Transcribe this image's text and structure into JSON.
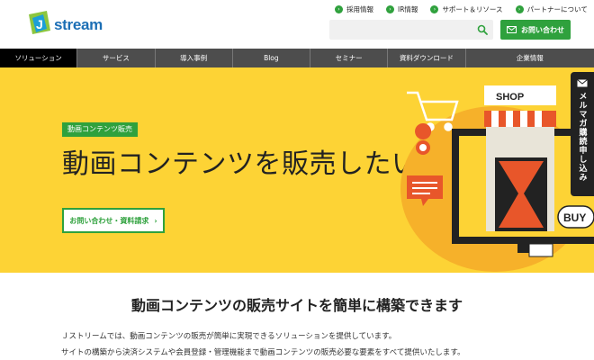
{
  "header": {
    "logo_text": "stream",
    "logo_letter": "J",
    "util_links": [
      {
        "label": "採用情報"
      },
      {
        "label": "IR情報"
      },
      {
        "label": "サポート＆リソース"
      },
      {
        "label": "パートナーについて"
      }
    ],
    "search": {
      "placeholder": "",
      "value": ""
    },
    "contact_label": "お問い合わせ"
  },
  "nav": {
    "items": [
      {
        "label": "ソリューション",
        "active": true
      },
      {
        "label": "サービス"
      },
      {
        "label": "導入事例"
      },
      {
        "label": "Blog"
      },
      {
        "label": "セミナー"
      },
      {
        "label": "資料ダウンロード"
      },
      {
        "label": "企業情報"
      }
    ]
  },
  "hero": {
    "badge": "動画コンテンツ販売",
    "title": "動画コンテンツを販売したい",
    "cta_label": "お問い合わせ・資料請求",
    "cta_arrow": "›",
    "shop_sign": "SHOP",
    "buy_label": "BUY"
  },
  "side_tab": {
    "label": "メルマガ購読申し込み"
  },
  "main": {
    "section_title": "動画コンテンツの販売サイトを簡単に構築できます",
    "intro_lines": [
      "Ｊストリームでは、動画コンテンツの販売が簡単に実現できるソリューションを提供しています。",
      "サイトの構築から決済システムや会員登録・管理機能まで動画コンテンツの販売必要な要素をすべて提供いたします。"
    ]
  },
  "colors": {
    "brand_green": "#2fa13d",
    "hero_yellow": "#fdd335",
    "nav_gray": "#4d4d4d",
    "logo_blue": "#1c6fb5"
  }
}
